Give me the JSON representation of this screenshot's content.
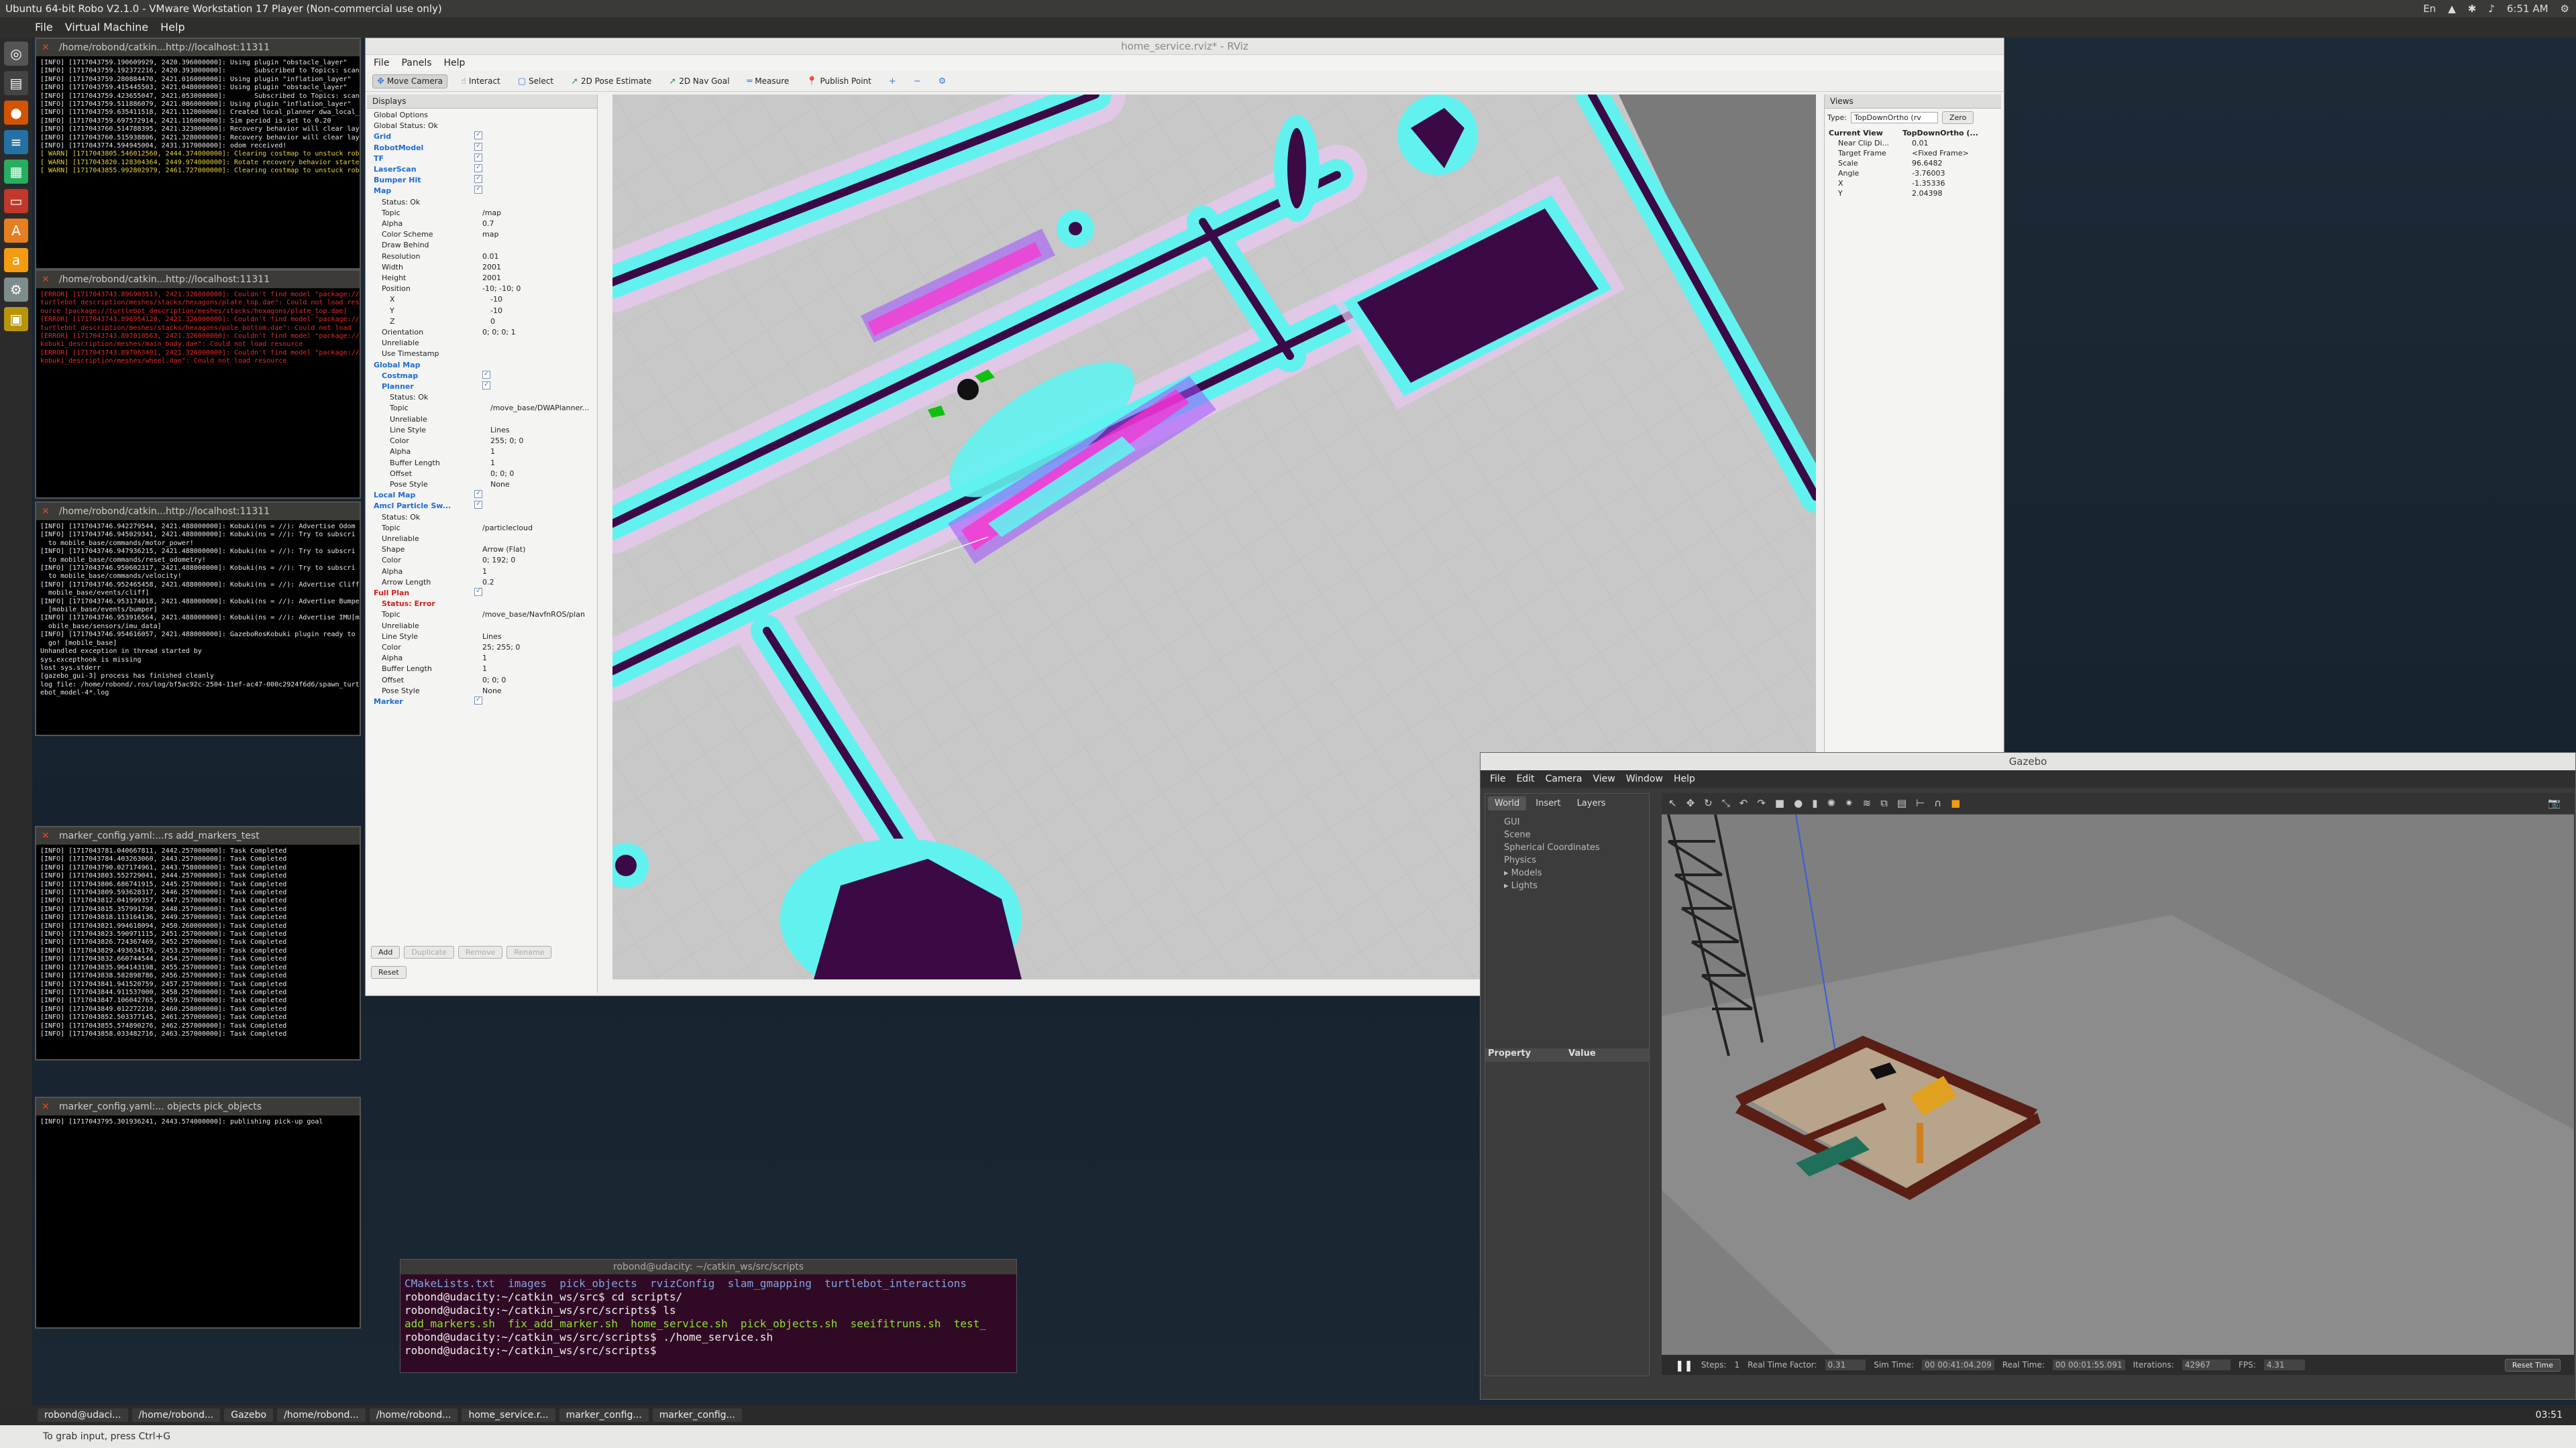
{
  "vm": {
    "title": "Ubuntu 64-bit Robo V2.1.0 - VMware Workstation 17 Player (Non-commercial use only)",
    "menu": [
      "File",
      "Virtual Machine",
      "Help"
    ],
    "clock": "6:51 AM",
    "tray_lang": "En"
  },
  "terminals": [
    {
      "title": "/home/robond/catkin...http://localhost:11311",
      "lines": [
        "[INFO] [1717043759.190609929, 2420.396000000]: Using plugin \"obstacle_layer\"",
        "[INFO] [1717043759.192372216, 2420.393000000]:       Subscribed to Topics: scan b",
        "[INFO] [1717043759.280884470, 2421.016000000]: Using plugin \"inflation_layer\"",
        "[INFO] [1717043759.415445503, 2421.048000000]: Using plugin \"obstacle_layer\"",
        "[INFO] [1717043759.423655047, 2421.053000000]:       Subscribed to Topics: scan b",
        "[INFO] [1717043759.511886079, 2421.086000000]: Using plugin \"inflation_layer\"",
        "[INFO] [1717043759.635411518, 2421.112000000]: Created local_planner dwa_local_",
        "[INFO] [1717043759.697572914, 2421.116000000]: Sim period is set to 0.20",
        "[INFO] [1717043760.514788395, 2421.323000000]: Recovery behavior will clear lay",
        "[INFO] [1717043760.515938806, 2421.328000000]: Recovery behavior will clear lay",
        "[INFO] [1717043774.594945004, 2431.317000000]: odom received!",
        "[ WARN] [1717043805.546012560, 2444.374000000]: Clearing costmap to unstuck robo",
        "[ WARN] [1717043820.128304364, 2449.974000000]: Rotate recovery behavior started",
        "[ WARN] [1717043855.992802979, 2461.727000000]: Clearing costmap to unstuck robo"
      ]
    },
    {
      "title": "/home/robond/catkin...http://localhost:11311",
      "lines": [
        "[ERROR] [1717043743.896903513, 2421.326000000]: Couldn't find model \"package://",
        "turtlebot_description/meshes/stacks/hexagons/plate_top.dae\": Could not load res",
        "ource [package://turtlebot_description/meshes/stacks/hexagons/plate_top.dae]",
        "[ERROR] [1717043743.896954128, 2421.326000000]: Couldn't find model \"package://",
        "turtlebot_description/meshes/stacks/hexagons/pole_bottom.dae\": Could not load",
        "[ERROR] [1717043743.897010563, 2421.326000000]: Couldn't find model \"package://",
        "kobuki_description/meshes/main_body.dae\": Could not load resource",
        "[ERROR] [1717043743.897063401, 2421.326000000]: Couldn't find model \"package://",
        "kobuki_description/meshes/wheel.dae\": Could not load resource"
      ]
    },
    {
      "title": "/home/robond/catkin...http://localhost:11311",
      "lines": [
        "[INFO] [1717043746.942279544, 2421.488000000]: Kobuki(ns = //): Advertise Odom",
        "[INFO] [1717043746.945029341, 2421.488000000]: Kobuki(ns = //): Try to subscri",
        "  to mobile_base/commands/motor_power!",
        "[INFO] [1717043746.947936215, 2421.488000000]: Kobuki(ns = //): Try to subscri",
        "  to mobile_base/commands/reset_odometry!",
        "[INFO] [1717043746.950602317, 2421.488000000]: Kobuki(ns = //): Try to subscri",
        "  to mobile_base/commands/velocity!",
        "[INFO] [1717043746.952465458, 2421.488000000]: Kobuki(ns = //): Advertise Cliff",
        "  mobile_base/events/cliff]",
        "[INFO] [1717043746.953174018, 2421.488000000]: Kobuki(ns = //): Advertise Bumpe",
        "  [mobile_base/events/bumper]",
        "[INFO] [1717043746.953916564, 2421.488000000]: Kobuki(ns = //): Advertise IMU[m",
        "  obile_base/sensors/imu_data]",
        "[INFO] [1717043746.954616057, 2421.488000000]: GazeboRosKobuki plugin ready to",
        "  go! [mobile_base]",
        "Unhandled exception in thread started by",
        "sys.excepthook is missing",
        "lost sys.stderr",
        "[gazebo_gui-3] process has finished cleanly",
        "log file: /home/robond/.ros/log/bf5ac92c-2504-11ef-ac47-000c2924f6d6/spawn_turtl",
        "ebot_model-4*.log"
      ]
    },
    {
      "title": "marker_config.yaml:...rs add_markers_test",
      "lines": [
        "[INFO] [1717043781.040667811, 2442.257000000]: Task Completed",
        "[INFO] [1717043784.403263060, 2443.257000000]: Task Completed",
        "[INFO] [1717043790.027174961, 2443.758000000]: Task Completed",
        "[INFO] [1717043803.552729041, 2444.257000000]: Task Completed",
        "[INFO] [1717043806.686741915, 2445.257000000]: Task Completed",
        "[INFO] [1717043809.593628317, 2446.257000000]: Task Completed",
        "[INFO] [1717043812.041999357, 2447.257000000]: Task Completed",
        "[INFO] [1717043815.357991798, 2448.257000000]: Task Completed",
        "[INFO] [1717043818.113164136, 2449.257000000]: Task Completed",
        "[INFO] [1717043821.994618094, 2450.260000000]: Task Completed",
        "[INFO] [1717043823.590971115, 2451.257000000]: Task Completed",
        "[INFO] [1717043826.724367469, 2452.257000000]: Task Completed",
        "[INFO] [1717043829.493634176, 2453.257000000]: Task Completed",
        "[INFO] [1717043832.660744544, 2454.257000000]: Task Completed",
        "[INFO] [1717043835.964143198, 2455.257000000]: Task Completed",
        "[INFO] [1717043838.582898786, 2456.257000000]: Task Completed",
        "[INFO] [1717043841.941520759, 2457.257000000]: Task Completed",
        "[INFO] [1717043844.911537000, 2458.257000000]: Task Completed",
        "[INFO] [1717043847.106042765, 2459.257000000]: Task Completed",
        "[INFO] [1717043849.012272210, 2460.258000000]: Task Completed",
        "[INFO] [1717043852.503377145, 2461.257000000]: Task Completed",
        "[INFO] [1717043855.574890276, 2462.257000000]: Task Completed",
        "[INFO] [1717043858.033482716, 2463.257000000]: Task Completed"
      ]
    },
    {
      "title": "marker_config.yaml:... objects pick_objects",
      "lines": [
        "[INFO] [1717043795.301936241, 2443.574000000]: publishing pick-up goal"
      ]
    }
  ],
  "rviz": {
    "title": "home_service.rviz* - RViz",
    "menu": [
      "File",
      "Panels",
      "Help"
    ],
    "tools": [
      {
        "label": "Move Camera",
        "icon": "move-camera-icon"
      },
      {
        "label": "Interact",
        "icon": "interact-icon"
      },
      {
        "label": "Select",
        "icon": "select-icon"
      },
      {
        "label": "2D Pose Estimate",
        "icon": "pose-estimate-icon"
      },
      {
        "label": "2D Nav Goal",
        "icon": "nav-goal-icon"
      },
      {
        "label": "Measure",
        "icon": "measure-icon"
      },
      {
        "label": "Publish Point",
        "icon": "publish-point-icon"
      }
    ],
    "displays_title": "Displays",
    "displays": [
      {
        "name": "Global Options",
        "value": "",
        "indent": 0,
        "style": ""
      },
      {
        "name": "Global Status: Ok",
        "value": "",
        "indent": 0,
        "style": ""
      },
      {
        "name": "Grid",
        "value": "✓",
        "indent": 0,
        "style": "blue"
      },
      {
        "name": "RobotModel",
        "value": "✓",
        "indent": 0,
        "style": "blue"
      },
      {
        "name": "TF",
        "value": "✓",
        "indent": 0,
        "style": "blue"
      },
      {
        "name": "LaserScan",
        "value": "✓",
        "indent": 0,
        "style": "blue"
      },
      {
        "name": "Bumper Hit",
        "value": "✓",
        "indent": 0,
        "style": "blue"
      },
      {
        "name": "Map",
        "value": "✓",
        "indent": 0,
        "style": "blue"
      },
      {
        "name": "Status: Ok",
        "value": "",
        "indent": 1,
        "style": ""
      },
      {
        "name": "Topic",
        "value": "/map",
        "indent": 1,
        "style": ""
      },
      {
        "name": "Alpha",
        "value": "0.7",
        "indent": 1,
        "style": ""
      },
      {
        "name": "Color Scheme",
        "value": "map",
        "indent": 1,
        "style": ""
      },
      {
        "name": "Draw Behind",
        "value": "",
        "indent": 1,
        "style": ""
      },
      {
        "name": "Resolution",
        "value": "0.01",
        "indent": 1,
        "style": ""
      },
      {
        "name": "Width",
        "value": "2001",
        "indent": 1,
        "style": ""
      },
      {
        "name": "Height",
        "value": "2001",
        "indent": 1,
        "style": ""
      },
      {
        "name": "Position",
        "value": "-10; -10; 0",
        "indent": 1,
        "style": ""
      },
      {
        "name": "X",
        "value": "-10",
        "indent": 2,
        "style": ""
      },
      {
        "name": "Y",
        "value": "-10",
        "indent": 2,
        "style": ""
      },
      {
        "name": "Z",
        "value": "0",
        "indent": 2,
        "style": ""
      },
      {
        "name": "Orientation",
        "value": "0; 0; 0; 1",
        "indent": 1,
        "style": ""
      },
      {
        "name": "Unreliable",
        "value": "",
        "indent": 1,
        "style": ""
      },
      {
        "name": "Use Timestamp",
        "value": "",
        "indent": 1,
        "style": ""
      },
      {
        "name": "Global Map",
        "value": "",
        "indent": 0,
        "style": "blue"
      },
      {
        "name": "Costmap",
        "value": "✓",
        "indent": 1,
        "style": "blue"
      },
      {
        "name": "Planner",
        "value": "✓",
        "indent": 1,
        "style": "blue"
      },
      {
        "name": "Status: Ok",
        "value": "",
        "indent": 2,
        "style": ""
      },
      {
        "name": "Topic",
        "value": "/move_base/DWAPlanner...",
        "indent": 2,
        "style": ""
      },
      {
        "name": "Unreliable",
        "value": "",
        "indent": 2,
        "style": ""
      },
      {
        "name": "Line Style",
        "value": "Lines",
        "indent": 2,
        "style": ""
      },
      {
        "name": "Color",
        "value": "255; 0; 0",
        "indent": 2,
        "style": ""
      },
      {
        "name": "Alpha",
        "value": "1",
        "indent": 2,
        "style": ""
      },
      {
        "name": "Buffer Length",
        "value": "1",
        "indent": 2,
        "style": ""
      },
      {
        "name": "Offset",
        "value": "0; 0; 0",
        "indent": 2,
        "style": ""
      },
      {
        "name": "Pose Style",
        "value": "None",
        "indent": 2,
        "style": ""
      },
      {
        "name": "Local Map",
        "value": "✓",
        "indent": 0,
        "style": "blue"
      },
      {
        "name": "Amcl Particle Sw...",
        "value": "✓",
        "indent": 0,
        "style": "blue"
      },
      {
        "name": "Status: Ok",
        "value": "",
        "indent": 1,
        "style": ""
      },
      {
        "name": "Topic",
        "value": "/particlecloud",
        "indent": 1,
        "style": ""
      },
      {
        "name": "Unreliable",
        "value": "",
        "indent": 1,
        "style": ""
      },
      {
        "name": "Shape",
        "value": "Arrow (Flat)",
        "indent": 1,
        "style": ""
      },
      {
        "name": "Color",
        "value": "0; 192; 0",
        "indent": 1,
        "style": ""
      },
      {
        "name": "Alpha",
        "value": "1",
        "indent": 1,
        "style": ""
      },
      {
        "name": "Arrow Length",
        "value": "0.2",
        "indent": 1,
        "style": ""
      },
      {
        "name": "Full Plan",
        "value": "✓",
        "indent": 0,
        "style": "err"
      },
      {
        "name": "Status: Error",
        "value": "",
        "indent": 1,
        "style": "err"
      },
      {
        "name": "Topic",
        "value": "/move_base/NavfnROS/plan",
        "indent": 1,
        "style": ""
      },
      {
        "name": "Unreliable",
        "value": "",
        "indent": 1,
        "style": ""
      },
      {
        "name": "Line Style",
        "value": "Lines",
        "indent": 1,
        "style": ""
      },
      {
        "name": "Color",
        "value": "25; 255; 0",
        "indent": 1,
        "style": ""
      },
      {
        "name": "Alpha",
        "value": "1",
        "indent": 1,
        "style": ""
      },
      {
        "name": "Buffer Length",
        "value": "1",
        "indent": 1,
        "style": ""
      },
      {
        "name": "Offset",
        "value": "0; 0; 0",
        "indent": 1,
        "style": ""
      },
      {
        "name": "Pose Style",
        "value": "None",
        "indent": 1,
        "style": ""
      },
      {
        "name": "Marker",
        "value": "✓",
        "indent": 0,
        "style": "blue"
      }
    ],
    "buttons": {
      "add": "Add",
      "duplicate": "Duplicate",
      "remove": "Remove",
      "rename": "Rename",
      "reset": "Reset"
    },
    "views": {
      "title": "Views",
      "type_label": "Type:",
      "type_value": "TopDownOrtho (rv",
      "zero": "Zero",
      "current_view": "Current View",
      "current_view_value": "TopDownOrtho (...",
      "props": [
        {
          "name": "Near Clip Di...",
          "value": "0.01"
        },
        {
          "name": "Target Frame",
          "value": "<Fixed Frame>"
        },
        {
          "name": "Scale",
          "value": "96.6482"
        },
        {
          "name": "Angle",
          "value": "-3.76003"
        },
        {
          "name": "X",
          "value": "-1.35336"
        },
        {
          "name": "Y",
          "value": "2.04398"
        }
      ]
    }
  },
  "gazebo": {
    "title": "Gazebo",
    "menu": [
      "File",
      "Edit",
      "Camera",
      "View",
      "Window",
      "Help"
    ],
    "tabs": [
      "World",
      "Insert",
      "Layers"
    ],
    "tree": [
      "GUI",
      "Scene",
      "Spherical Coordinates",
      "Physics",
      "Models",
      "Lights"
    ],
    "prop_headers": [
      "Property",
      "Value"
    ],
    "footer": {
      "steps_label": "Steps:",
      "steps": "1",
      "rtf_label": "Real Time Factor:",
      "rtf": "0.31",
      "sim_label": "Sim Time:",
      "sim": "00 00:41:04.209",
      "real_label": "Real Time:",
      "real": "00 00:01:55.091",
      "iter_label": "Iterations:",
      "iter": "42967",
      "fps_label": "FPS:",
      "fps": "4.31",
      "reset": "Reset Time"
    }
  },
  "shell": {
    "title": "robond@udacity: ~/catkin_ws/src/scripts",
    "ls1": "CMakeLists.txt  images  pick_objects  rvizConfig  slam_gmapping  turtlebot_interactions",
    "l2": "robond@udacity:~/catkin_ws/src$ cd scripts/",
    "l3": "robond@udacity:~/catkin_ws/src/scripts$ ls",
    "ls2": "add_markers.sh  fix_add_marker.sh  home_service.sh  pick_objects.sh  seeifitruns.sh  test_",
    "l5": "robond@udacity:~/catkin_ws/src/scripts$ ./home_service.sh",
    "l6": "robond@udacity:~/catkin_ws/src/scripts$ "
  },
  "taskbar": {
    "items": [
      "robond@udaci...",
      "/home/robond...",
      "Gazebo",
      "/home/robond...",
      "/home/robond...",
      "home_service.r...",
      "marker_config...",
      "marker_config..."
    ],
    "time": "03:51"
  },
  "statusbar": "To grab input, press Ctrl+G",
  "colors": {
    "accent": "#3a7bd5",
    "error": "#e52a2a",
    "warn": "#e8d23a",
    "map_floor": "#c8c8c8",
    "map_wall": "#3b0a45",
    "map_inflation": "#61f2f0"
  }
}
